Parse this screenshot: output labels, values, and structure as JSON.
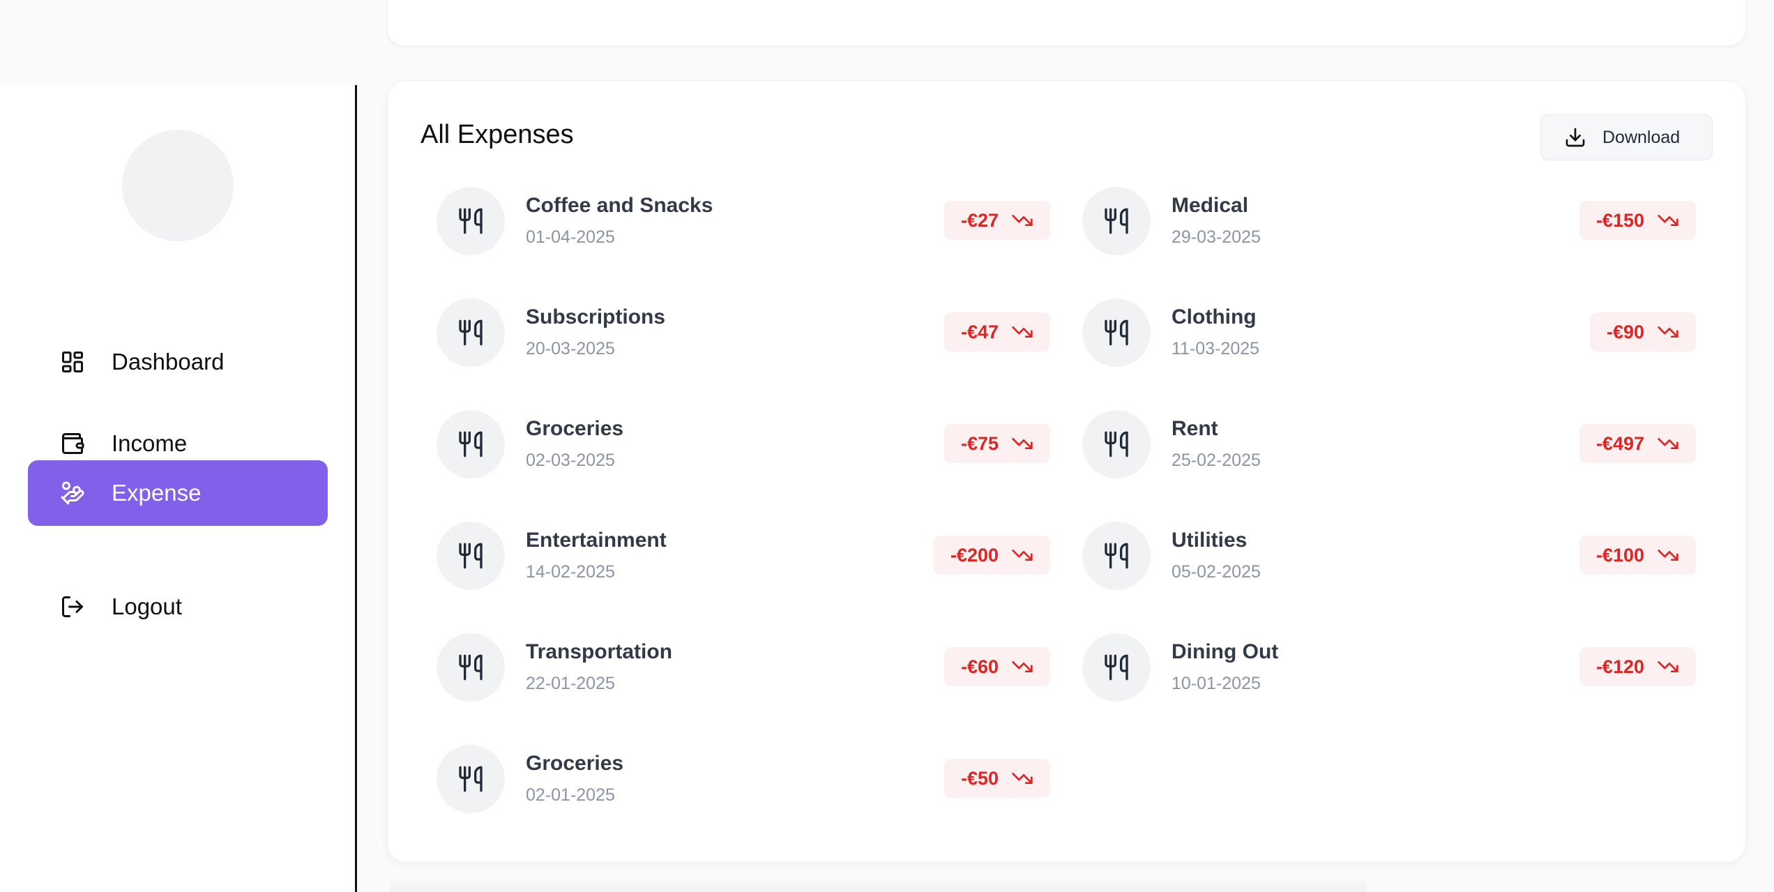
{
  "sidebar": {
    "items": [
      {
        "label": "Dashboard",
        "icon": "dashboard-icon"
      },
      {
        "label": "Income",
        "icon": "wallet-icon"
      },
      {
        "label": "Expense",
        "icon": "hand-coins-icon"
      },
      {
        "label": "Logout",
        "icon": "logout-icon"
      }
    ],
    "active": "Expense",
    "accent": "#8360ea"
  },
  "main": {
    "title": "All Expenses",
    "download_label": "Download",
    "expenses": [
      {
        "name": "Coffee and Snacks",
        "date": "01-04-2025",
        "amount": "-€27"
      },
      {
        "name": "Medical",
        "date": "29-03-2025",
        "amount": "-€150"
      },
      {
        "name": "Subscriptions",
        "date": "20-03-2025",
        "amount": "-€47"
      },
      {
        "name": "Clothing",
        "date": "11-03-2025",
        "amount": "-€90"
      },
      {
        "name": "Groceries",
        "date": "02-03-2025",
        "amount": "-€75"
      },
      {
        "name": "Rent",
        "date": "25-02-2025",
        "amount": "-€497"
      },
      {
        "name": "Entertainment",
        "date": "14-02-2025",
        "amount": "-€200"
      },
      {
        "name": "Utilities",
        "date": "05-02-2025",
        "amount": "-€100"
      },
      {
        "name": "Transportation",
        "date": "22-01-2025",
        "amount": "-€60"
      },
      {
        "name": "Dining Out",
        "date": "10-01-2025",
        "amount": "-€120"
      },
      {
        "name": "Groceries",
        "date": "02-01-2025",
        "amount": "-€50"
      }
    ],
    "expense_icon": "utensils-icon",
    "trend_icon": "trending-down-icon",
    "negative_color": "#dc2626"
  }
}
